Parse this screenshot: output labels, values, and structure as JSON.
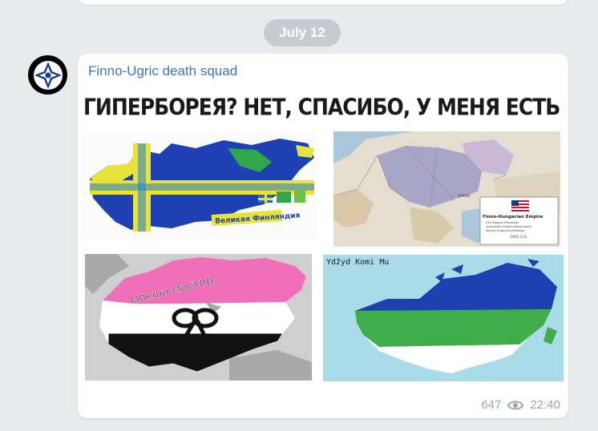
{
  "date_separator": "July 12",
  "message": {
    "sender": "Finno-Ugric death squad",
    "image": {
      "heading": "ГИПЕРБОРЕЯ? НЕТ, СПАСИБО, У МЕНЯ ЕСТЬ ЭТО:",
      "panel1_label": "Великая Финляндия",
      "panel2_legend_title": "Finno-Hungarian Empire",
      "panel2_legend_lines": [
        "Finn-Magyar Birodalom",
        "Suomalais-Unkarin Keisarikunta",
        "Финно-Угорская империя"
      ],
      "panel2_legend_year": "1905 A.D.",
      "panel2_place_label": "SARAY",
      "panel3_label": "мокша мастор",
      "panel4_label": "Ydžyd Komi Mu"
    },
    "views": "647",
    "time": "22:40"
  },
  "colors": {
    "background": "#e6ebee",
    "bubble": "#ffffff",
    "sender": "#3a78b7",
    "date_pill": "#c4ccd2",
    "meta": "#9aa6b0"
  },
  "icons": {
    "views": "eye-icon",
    "avatar": "star-emblem-icon"
  }
}
